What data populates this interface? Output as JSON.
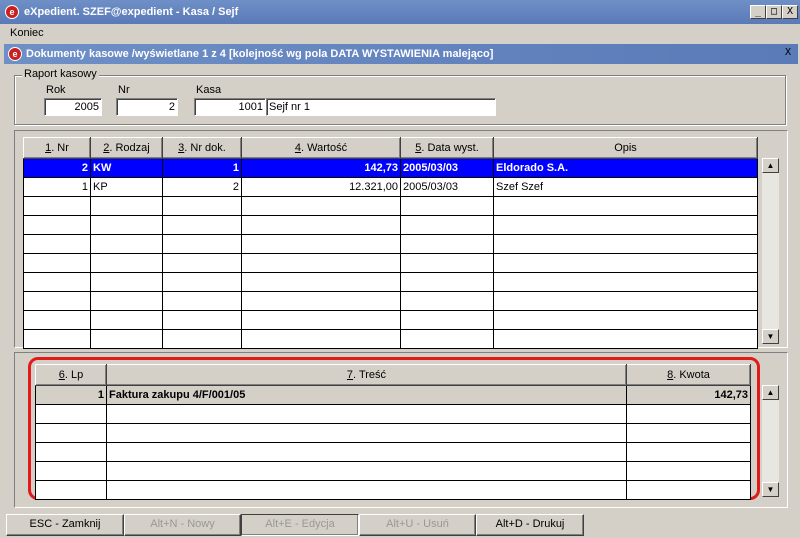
{
  "window": {
    "title": "eXpedient. SZEF@expedient  - Kasa / Sejf",
    "icon": "e",
    "min_label": "_",
    "max_label": "□",
    "close_label": "X"
  },
  "menu": {
    "items": [
      "Koniec"
    ]
  },
  "subwindow": {
    "title": "Dokumenty kasowe /wyświetlane 1 z 4 [kolejność wg pola DATA WYSTAWIENIA malejąco]",
    "close_label": "X"
  },
  "raport": {
    "legend": "Raport kasowy",
    "rok_label": "Rok",
    "rok": "2005",
    "nr_label": "Nr",
    "nr": "2",
    "kasa_label": "Kasa",
    "kasa_id": "1001",
    "kasa_name": "Sejf nr 1"
  },
  "documents": {
    "headers": {
      "nr": [
        "1",
        ". Nr"
      ],
      "rodzaj": [
        "2",
        ". Rodzaj"
      ],
      "nrdok": [
        "3",
        ". Nr dok."
      ],
      "wartosc": [
        "4",
        ". Wartość"
      ],
      "data": [
        "5",
        ". Data wyst."
      ],
      "opis": [
        "",
        "Opis"
      ]
    },
    "rows": [
      {
        "nr": "2",
        "rodzaj": "KW",
        "nrdok": "1",
        "wartosc": "142,73",
        "data": "2005/03/03",
        "opis": "Eldorado S.A."
      },
      {
        "nr": "1",
        "rodzaj": "KP",
        "nrdok": "2",
        "wartosc": "12.321,00",
        "data": "2005/03/03",
        "opis": "Szef Szef"
      }
    ],
    "empty_rows": 8
  },
  "items": {
    "headers": {
      "lp": [
        "6",
        ". Lp"
      ],
      "tresc": [
        "7",
        ". Treść"
      ],
      "kwota": [
        "8",
        ". Kwota"
      ]
    },
    "rows": [
      {
        "lp": "1",
        "tresc": "Faktura zakupu 4/F/001/05",
        "kwota": "142,73"
      }
    ],
    "empty_rows": 5
  },
  "scroll": {
    "up_icon": "▲",
    "down_icon": "▼"
  },
  "buttons": {
    "close": "ESC - Zamknij",
    "new": "Alt+N - Nowy",
    "edit": "Alt+E - Edycja",
    "delete": "Alt+U - Usuń",
    "print": "Alt+D - Drukuj"
  }
}
